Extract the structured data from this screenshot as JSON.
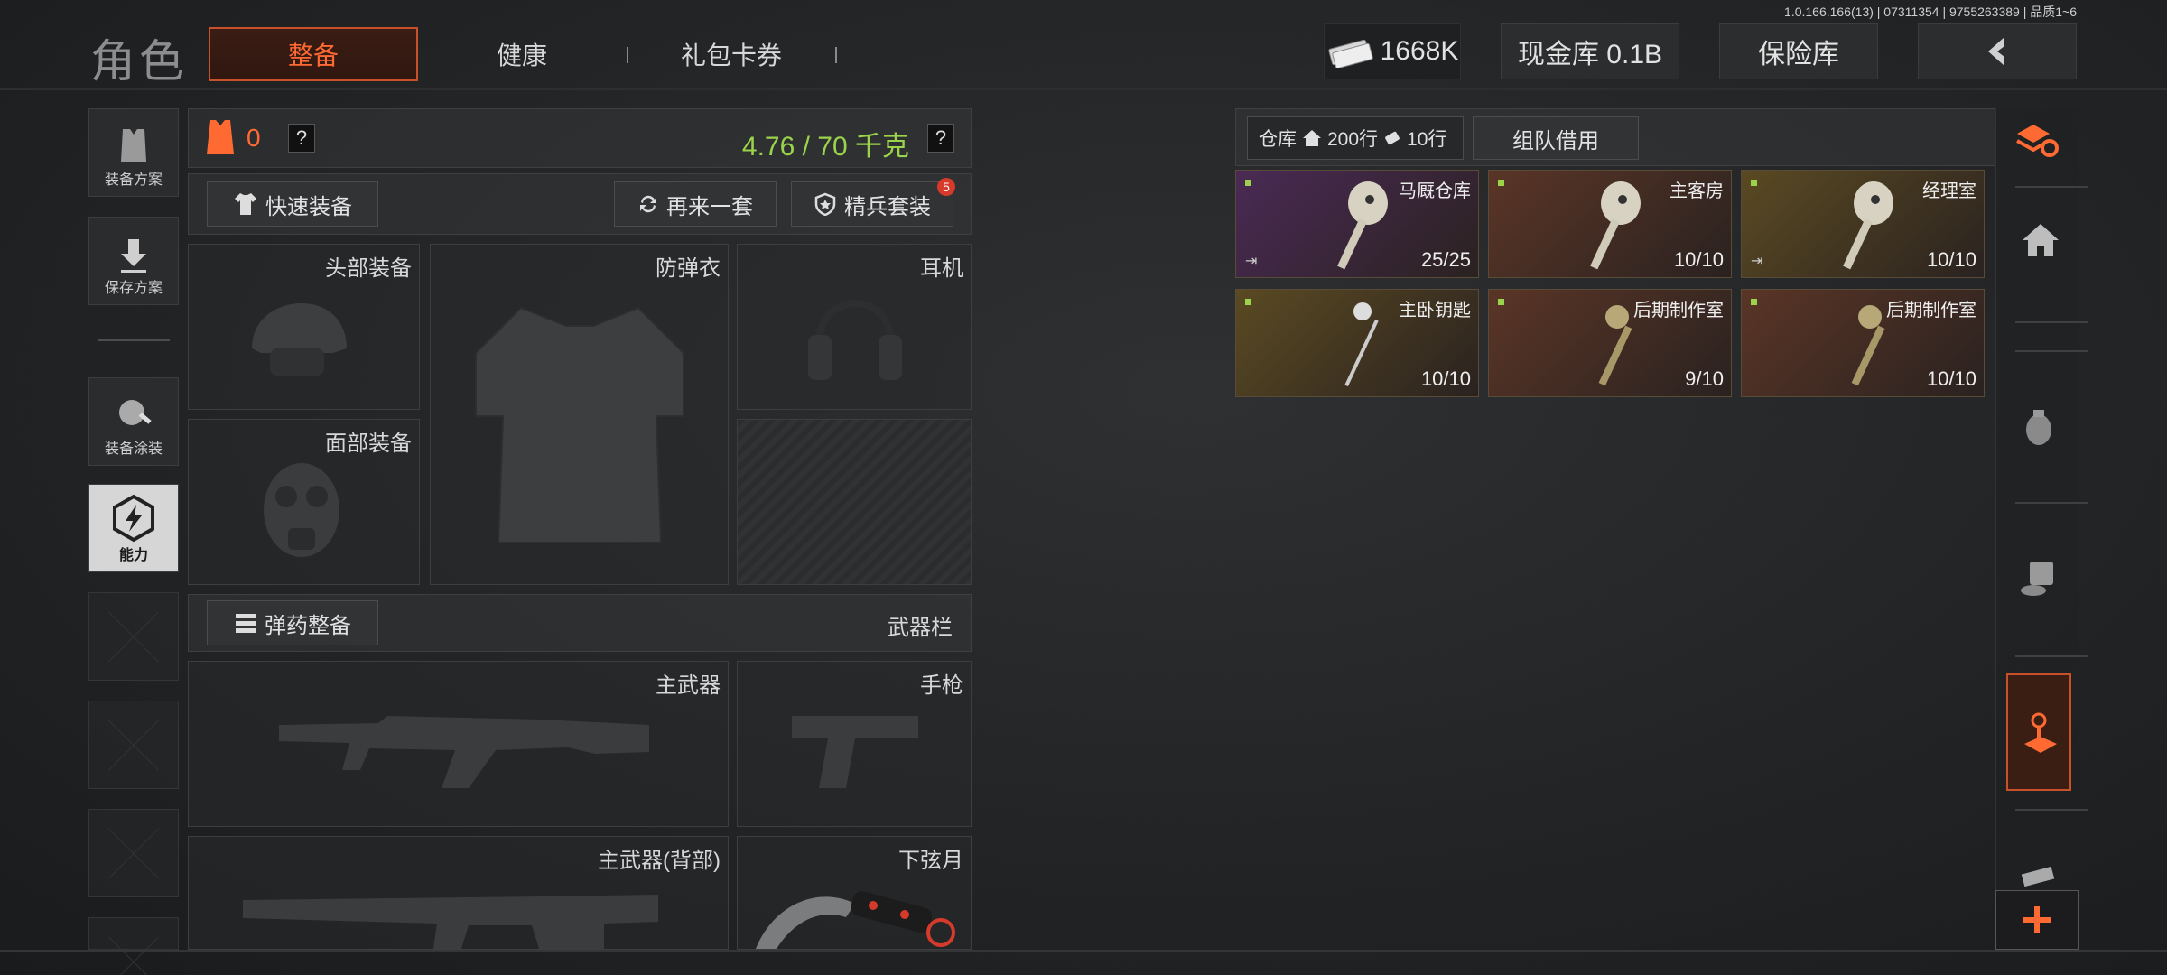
{
  "version_info": "1.0.166.166(13) | 07311354 | 9755263389 | 品质1~6",
  "header": {
    "title": "角色",
    "tabs": [
      {
        "label": "整备",
        "active": true
      },
      {
        "label": "健康",
        "active": false
      },
      {
        "label": "礼包卡券",
        "active": false
      }
    ],
    "currency": "1668K",
    "cash_vault": "现金库 0.1B",
    "insurance": "保险库"
  },
  "left_nav": {
    "loadout_plan": "装备方案",
    "save_plan": "保存方案",
    "skin": "装备涂装",
    "ability": "能力"
  },
  "gear": {
    "armor_count": "0",
    "weight": "4.76 / 70 千克",
    "help": "?",
    "quick_equip": "快速装备",
    "again": "再来一套",
    "elite_set": "精兵套装",
    "elite_badge": "5",
    "slots": {
      "head": "头部装备",
      "vest": "防弹衣",
      "headset": "耳机",
      "face": "面部装备"
    }
  },
  "weapons": {
    "ammo_btn": "弹药整备",
    "section_label": "武器栏",
    "primary": "主武器",
    "pistol": "手枪",
    "primary_back": "主武器(背部)",
    "melee": "下弦月"
  },
  "warehouse": {
    "label": "仓库",
    "rows": "200行",
    "rows2": "10行",
    "team_borrow": "组队借用",
    "items": [
      {
        "name": "马厩仓库",
        "count": "25/25",
        "color": "#4a2a55"
      },
      {
        "name": "主客房",
        "count": "10/10",
        "color": "#5a3526"
      },
      {
        "name": "经理室",
        "count": "10/10",
        "color": "#5a4a22"
      },
      {
        "name": "主卧钥匙",
        "count": "10/10",
        "color": "#5a4a22"
      },
      {
        "name": "后期制作室",
        "count": "9/10",
        "color": "#5a3526"
      },
      {
        "name": "后期制作室",
        "count": "10/10",
        "color": "#5a3526"
      }
    ]
  },
  "colors": {
    "accent": "#ff6a33",
    "weight_green": "#9bd34a"
  }
}
